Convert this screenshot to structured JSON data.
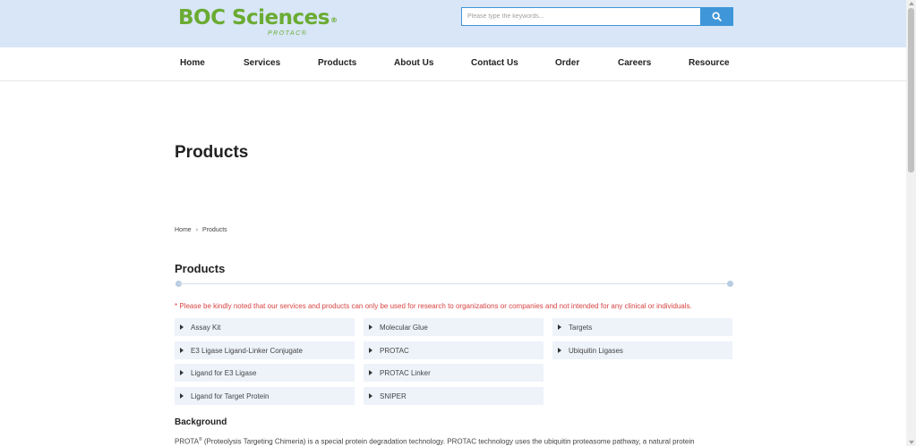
{
  "header": {
    "logo_main": "BOC Sciences",
    "logo_reg": "®",
    "logo_sub": "PROTAC®",
    "search_placeholder": "Please type the keywords...",
    "search_icon": "search-icon"
  },
  "nav": {
    "items": [
      "Home",
      "Services",
      "Products",
      "About Us",
      "Contact Us",
      "Order",
      "Careers",
      "Resource"
    ]
  },
  "page": {
    "title": "Products",
    "breadcrumb": [
      "Home",
      "Products"
    ],
    "breadcrumb_sep": "›",
    "section_title": "Products",
    "notice": "* Please be kindly noted that our services and products can only be used for research to organizations or companies and not intended for any clinical or individuals."
  },
  "categories": {
    "col1": [
      "Assay Kit",
      "E3 Ligase Ligand-Linker Conjugate",
      "Ligand for E3 Ligase",
      "Ligand for Target Protein"
    ],
    "col2": [
      "Molecular Glue",
      "PROTAC",
      "PROTAC Linker",
      "SNIPER"
    ],
    "col3": [
      "Targets",
      "Ubiquitin Ligases"
    ]
  },
  "background": {
    "title": "Background",
    "text_start": "PROTA",
    "text_sup": "®",
    "text_rest": " (Proteolysis Targeting Chimeria) is a special protein degradation technology. PROTAC technology uses the ubiquitin proteasome pathway, a natural protein"
  },
  "colors": {
    "brand_green": "#6aab32",
    "accent_blue": "#3f96d8",
    "notice_red": "#d84343",
    "header_bg": "#d8e6f7"
  }
}
